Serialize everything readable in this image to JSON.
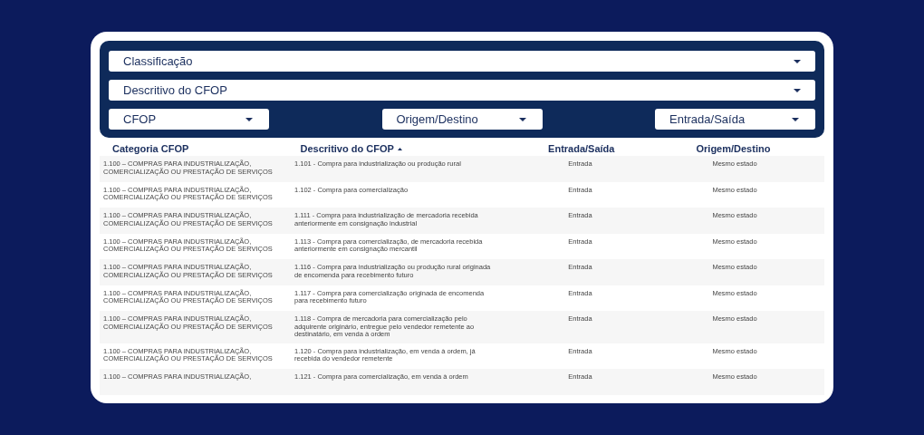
{
  "filters": {
    "full": [
      {
        "label": "Classificação"
      },
      {
        "label": "Descritivo do CFOP"
      }
    ],
    "small": [
      {
        "label": "CFOP"
      },
      {
        "label": "Origem/Destino"
      },
      {
        "label": "Entrada/Saída"
      }
    ]
  },
  "table": {
    "columns": [
      {
        "label": "Categoria CFOP",
        "sorted": false
      },
      {
        "label": "Descritivo do CFOP",
        "sorted": true
      },
      {
        "label": "Entrada/Saída",
        "sorted": false
      },
      {
        "label": "Origem/Destino",
        "sorted": false
      }
    ],
    "rows": [
      [
        "1.100 – COMPRAS PARA INDUSTRIALIZAÇÃO, COMERCIALIZAÇÃO OU PRESTAÇÃO DE SERVIÇOS",
        "1.101 - Compra para industrialização ou produção rural",
        "Entrada",
        "Mesmo estado"
      ],
      [
        "1.100 – COMPRAS PARA INDUSTRIALIZAÇÃO, COMERCIALIZAÇÃO OU PRESTAÇÃO DE SERVIÇOS",
        "1.102 - Compra para comercialização",
        "Entrada",
        "Mesmo estado"
      ],
      [
        "1.100 – COMPRAS PARA INDUSTRIALIZAÇÃO, COMERCIALIZAÇÃO OU PRESTAÇÃO DE SERVIÇOS",
        "1.111 - Compra para industrialização de mercadoria recebida anteriormente em consignação industrial",
        "Entrada",
        "Mesmo estado"
      ],
      [
        "1.100 – COMPRAS PARA INDUSTRIALIZAÇÃO, COMERCIALIZAÇÃO OU PRESTAÇÃO DE SERVIÇOS",
        "1.113 - Compra para comercialização, de mercadoria recebida anteriormente em consignação mercantil",
        "Entrada",
        "Mesmo estado"
      ],
      [
        "1.100 – COMPRAS PARA INDUSTRIALIZAÇÃO, COMERCIALIZAÇÃO OU PRESTAÇÃO DE SERVIÇOS",
        "1.116 - Compra para industrialização ou produção rural originada de encomenda para recebimento futuro",
        "Entrada",
        "Mesmo estado"
      ],
      [
        "1.100 – COMPRAS PARA INDUSTRIALIZAÇÃO, COMERCIALIZAÇÃO OU PRESTAÇÃO DE SERVIÇOS",
        "1.117 - Compra para comercialização originada de encomenda para recebimento futuro",
        "Entrada",
        "Mesmo estado"
      ],
      [
        "1.100 – COMPRAS PARA INDUSTRIALIZAÇÃO, COMERCIALIZAÇÃO OU PRESTAÇÃO DE SERVIÇOS",
        "1.118 - Compra de mercadoria para comercialização pelo adquirente originário, entregue pelo vendedor remetente ao destinatário, em venda à ordem",
        "Entrada",
        "Mesmo estado"
      ],
      [
        "1.100 – COMPRAS PARA INDUSTRIALIZAÇÃO, COMERCIALIZAÇÃO OU PRESTAÇÃO DE SERVIÇOS",
        "1.120 - Compra para industrialização, em venda à ordem, já recebida do vendedor remetente",
        "Entrada",
        "Mesmo estado"
      ],
      [
        "1.100 – COMPRAS PARA INDUSTRIALIZAÇÃO,",
        "1.121 - Compra para comercialização, em venda à ordem",
        "Entrada",
        "Mesmo estado"
      ]
    ]
  }
}
